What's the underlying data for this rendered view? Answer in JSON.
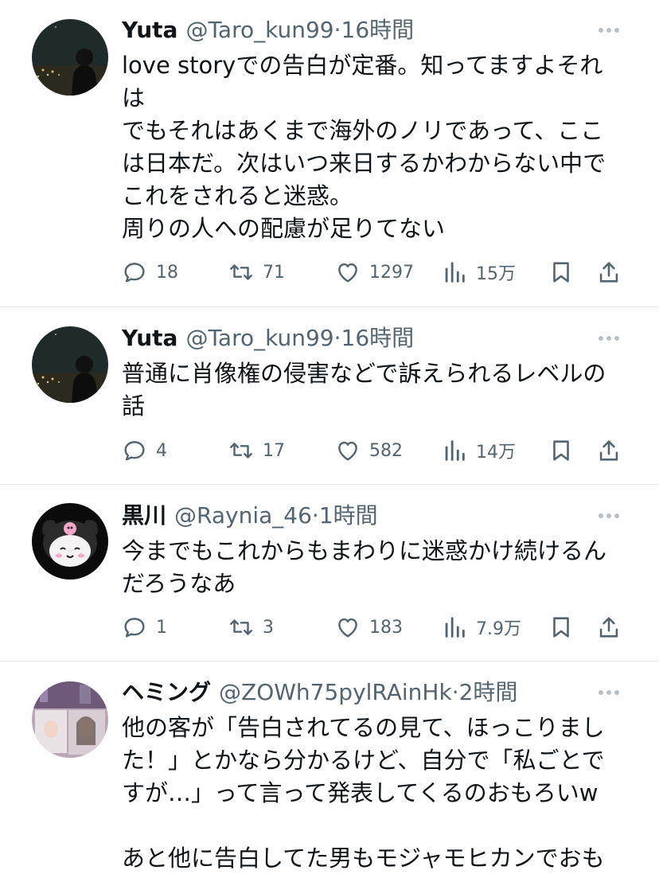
{
  "tweets": [
    {
      "name": "Yuta",
      "handle": "@Taro_kun99",
      "dot": "·",
      "time": "16時間",
      "text": "love storyでの告白が定番。知ってますよそれ\nは\nでもそれはあくまで海外のノリであって、ここ\nは日本だ。次はいつ来日するかわからない中で\nこれをされると迷惑。\n周りの人への配慮が足りてない",
      "replies": "18",
      "retweets": "71",
      "likes": "1297",
      "views": "15万",
      "avatar_icon": "night-city-avatar"
    },
    {
      "name": "Yuta",
      "handle": "@Taro_kun99",
      "dot": "·",
      "time": "16時間",
      "text": "普通に肖像権の侵害などで訴えられるレベルの\n話",
      "replies": "4",
      "retweets": "17",
      "likes": "582",
      "views": "14万",
      "avatar_icon": "night-city-avatar"
    },
    {
      "name": "黒川",
      "handle": "@Raynia_46",
      "dot": "·",
      "time": "1時間",
      "text": "今までもこれからもまわりに迷惑かけ続けるん\nだろうなあ",
      "replies": "1",
      "retweets": "3",
      "likes": "183",
      "views": "7.9万",
      "avatar_icon": "kuromi-avatar"
    },
    {
      "name": "ヘミング",
      "handle": "@ZOWh75pylRAinHk",
      "dot": "·",
      "time": "2時間",
      "text": "他の客が「告白されてるの見て、ほっこりまし\nた！」とかなら分かるけど、自分で「私ごとで\nすが…」って言って発表してくるのおもろいw\n\nあと他に告白してた男もモジャモヒカンでおも",
      "avatar_icon": "photo-avatar"
    }
  ],
  "colors": {
    "text": "#0f1419",
    "secondary": "#536471",
    "divider": "#e6e6e6",
    "icon": "#536471"
  }
}
